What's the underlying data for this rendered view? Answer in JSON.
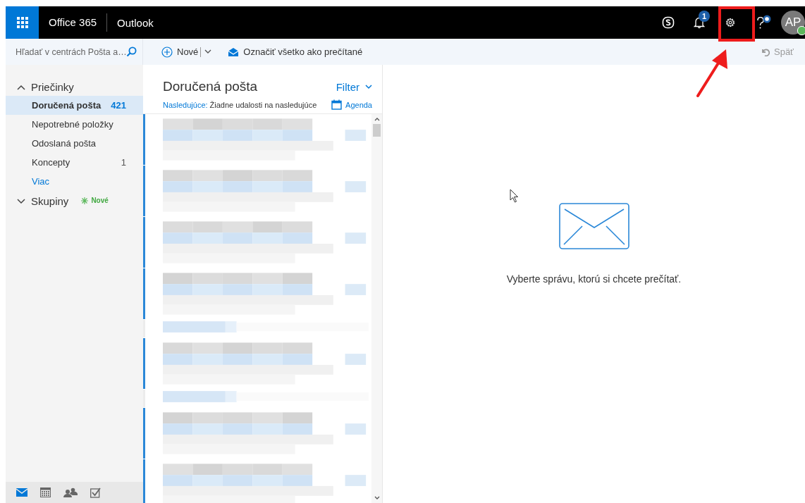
{
  "top_bar": {
    "brand": "Office 365",
    "app": "Outlook",
    "notifications_badge": "1",
    "avatar_initials": "AP"
  },
  "search": {
    "placeholder": "Hľadať v centrách Pošta a…"
  },
  "toolbar": {
    "new_label": "Nové",
    "mark_all_read": "Označiť všetko ako prečítané",
    "undo": {
      "label": "Späť",
      "disabled": true
    }
  },
  "folders": {
    "header": "Priečinky",
    "expanded": true,
    "items": [
      {
        "name": "Doručená pošta",
        "count": "421",
        "selected": true
      },
      {
        "name": "Nepotrebné položky",
        "selected": false
      },
      {
        "name": "Odoslaná pošta",
        "selected": false
      },
      {
        "name": "Koncepty",
        "count": "1",
        "selected": false
      }
    ],
    "more": "Viac"
  },
  "groups": {
    "header": "Skupiny",
    "expanded": false,
    "badge": "Nové"
  },
  "bottom_nav": [
    {
      "kind": "mail",
      "selected": true
    },
    {
      "kind": "calendar",
      "selected": false
    },
    {
      "kind": "people",
      "selected": false
    },
    {
      "kind": "tasks",
      "selected": false
    }
  ],
  "message_list": {
    "title": "Doručená pošta",
    "filter": "Filter",
    "next_label": "Nasledujúce:",
    "next_text": "Žiadne udalosti na nasledujúce",
    "agenda": "Agenda",
    "messages": [
      {
        "kind": "full",
        "unread": true
      },
      {
        "kind": "full",
        "unread": true
      },
      {
        "kind": "full",
        "unread": true
      },
      {
        "kind": "full",
        "unread": true
      },
      {
        "kind": "short",
        "unread": false
      },
      {
        "kind": "full",
        "unread": true
      },
      {
        "kind": "short",
        "unread": false
      },
      {
        "kind": "full",
        "unread": true
      },
      {
        "kind": "full",
        "unread": true
      }
    ]
  },
  "reading_pane": {
    "empty_text": "Vyberte správu, ktorú si chcete prečítať."
  }
}
